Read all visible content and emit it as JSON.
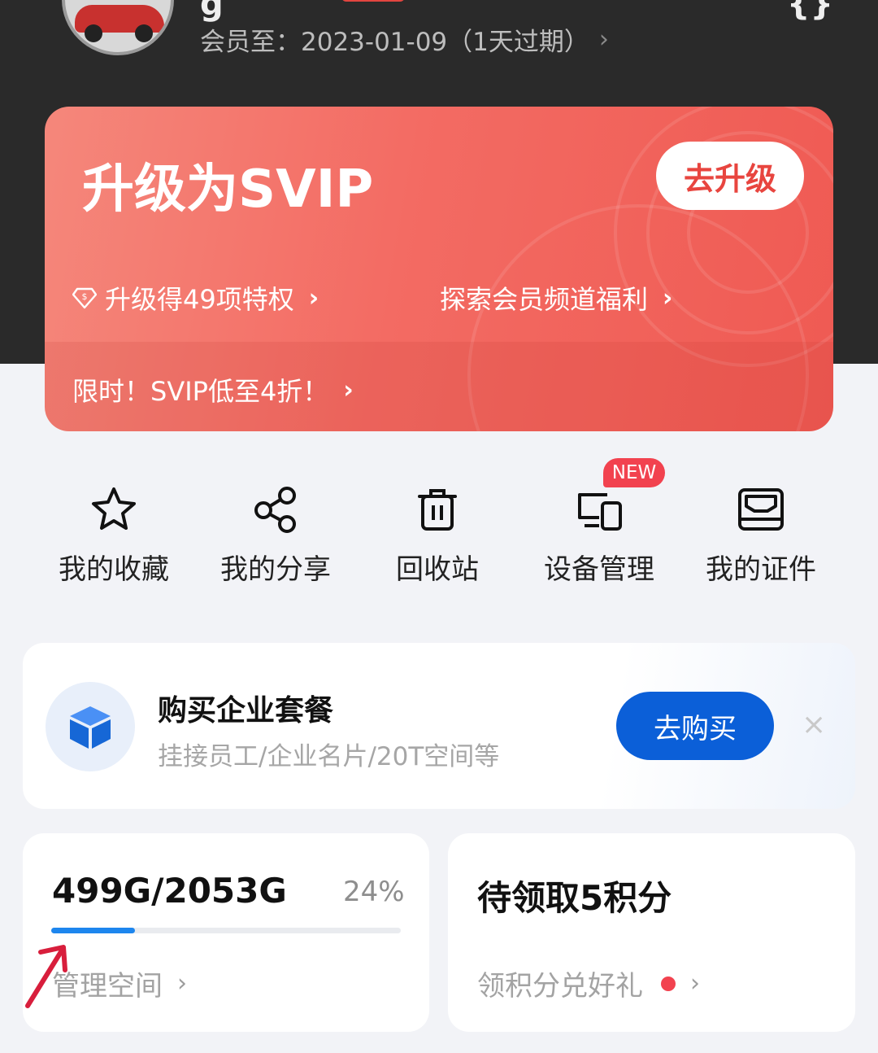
{
  "header": {
    "name_fragment": "g",
    "top_right_glyph": "{}",
    "membership_text": "会员至：2023-01-09（1天过期）",
    "chevron": "›"
  },
  "vip_card": {
    "title": "升级为SVIP",
    "upgrade_button": "去升级",
    "privileges_link": "升级得49项特权",
    "explore_link": "探索会员频道福利",
    "promo_link": "限时！SVIP低至4折！",
    "chevron": "›"
  },
  "shortcuts": {
    "items": [
      {
        "label": "我的收藏",
        "icon": "star-icon"
      },
      {
        "label": "我的分享",
        "icon": "share-icon"
      },
      {
        "label": "回收站",
        "icon": "trash-icon"
      },
      {
        "label": "设备管理",
        "icon": "devices-icon"
      },
      {
        "label": "我的证件",
        "icon": "id-card-icon"
      }
    ],
    "new_badge": "NEW"
  },
  "enterprise_banner": {
    "title": "购买企业套餐",
    "subtitle": "挂接员工/企业名片/20T空间等",
    "buy_button": "去购买",
    "close_glyph": "×",
    "icon": "cube-icon"
  },
  "storage_card": {
    "usage": "499G/2053G",
    "percent_text": "24%",
    "progress": 0.24,
    "manage_link": "管理空间",
    "chevron": "›"
  },
  "points_card": {
    "title": "待领取5积分",
    "redeem_link": "领积分兑好礼",
    "chevron": "›"
  },
  "colors": {
    "accent_red": "#e8453f",
    "accent_blue": "#0b5fd8",
    "progress_blue": "#1d86ee",
    "badge_red": "#f2424f"
  }
}
